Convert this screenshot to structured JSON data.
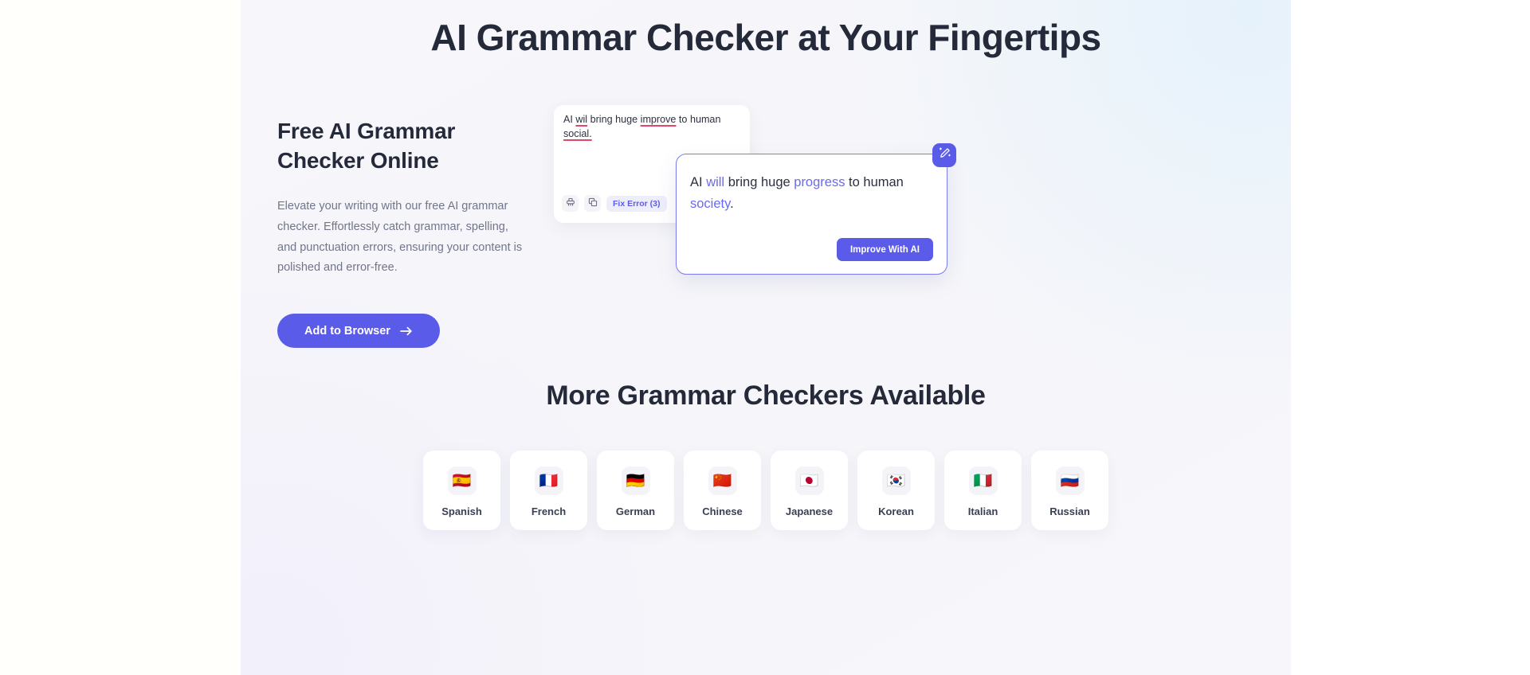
{
  "hero": {
    "title": "AI Grammar Checker at Your Fingertips",
    "subtitle": "Free AI Grammar Checker Online",
    "paragraph": "Elevate your writing with our free AI grammar checker. Effortlessly catch grammar, spelling, and punctuation errors, ensuring your content is polished and error-free.",
    "cta_label": "Add to Browser",
    "cta_icon": "arrow-right-icon"
  },
  "editor": {
    "text_before_error1": "AI ",
    "error1": "wil",
    "text_mid1": " bring huge ",
    "error2": "improve",
    "text_mid2": " to human ",
    "error3": "social.",
    "full_text": "AI wil bring huge improve to human social.",
    "toolbar": {
      "brush_icon": "brush-icon",
      "copy_icon": "copy-icon",
      "fix_error_label": "Fix Error (3)",
      "error_count": 3
    }
  },
  "suggestion": {
    "badge_icon": "magic-pencil-icon",
    "text_before": "AI ",
    "fix1": "will",
    "text_mid1": " bring huge ",
    "fix2": "progress",
    "text_mid2": " to human ",
    "fix3": "society",
    "text_end": ".",
    "full_text": "AI will bring huge progress to human society.",
    "cta_label": "Improve With AI"
  },
  "languages": {
    "heading": "More Grammar Checkers Available",
    "items": [
      {
        "label": "Spanish",
        "flag": "🇪🇸"
      },
      {
        "label": "French",
        "flag": "🇫🇷"
      },
      {
        "label": "German",
        "flag": "🇩🇪"
      },
      {
        "label": "Chinese",
        "flag": "🇨🇳"
      },
      {
        "label": "Japanese",
        "flag": "🇯🇵"
      },
      {
        "label": "Korean",
        "flag": "🇰🇷"
      },
      {
        "label": "Italian",
        "flag": "🇮🇹"
      },
      {
        "label": "Russian",
        "flag": "🇷🇺"
      }
    ]
  },
  "colors": {
    "accent": "#5b5bea",
    "accent_text": "#6a6af0",
    "error_underline": "#e0476a",
    "heading": "#252a3a",
    "body_text": "#71758a"
  }
}
